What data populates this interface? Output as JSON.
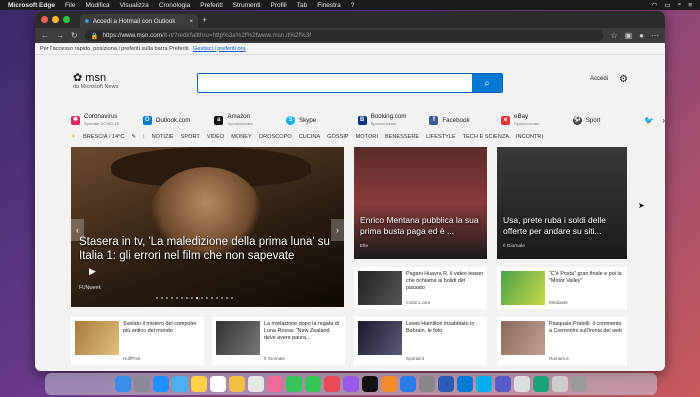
{
  "menubar": {
    "apple": "",
    "app": "Microsoft Edge",
    "items": [
      "File",
      "Modifica",
      "Visualizza",
      "Cronologia",
      "Preferiti",
      "Strumenti",
      "Profili",
      "Tab",
      "Finestra",
      "?"
    ]
  },
  "tab": {
    "title": "Accedi a Hotmail con Outlook"
  },
  "address": {
    "host": "https://www.msn.com",
    "path": "/it-it/?redirfallthru=http%3a%2f%2fwww.msn.it%2f%3f"
  },
  "favbar": {
    "text": "Per l'accesso rapido, posiziona i preferiti sulla barra Preferiti.",
    "link": "Gestisci i preferiti ora"
  },
  "logo": {
    "name": "msn",
    "sub": "da Microsoft News"
  },
  "header": {
    "signin": "Accedi"
  },
  "quick": [
    {
      "label": "Coronavirus",
      "sub": "Speciale COVID-19",
      "color": "#e0245e"
    },
    {
      "label": "Outlook.com",
      "sub": "",
      "color": "#0078d4"
    },
    {
      "label": "Amazon",
      "sub": "Sponsorizzato",
      "color": "#111"
    },
    {
      "label": "Skype",
      "sub": "",
      "color": "#00aff0"
    },
    {
      "label": "Booking.com",
      "sub": "Sponsorizzato",
      "color": "#003580"
    },
    {
      "label": "Facebook",
      "sub": "",
      "color": "#3b5998"
    },
    {
      "label": "eBay",
      "sub": "Sponsorizzato",
      "color": "#e53238"
    },
    {
      "label": "Sport",
      "sub": "",
      "color": "#444"
    }
  ],
  "weather": "BRESCIA / 14°C",
  "nav": [
    "NOTIZIE",
    "SPORT",
    "VIDEO",
    "MONEY",
    "OROSCOPO",
    "CUCINA",
    "GOSSIP",
    "MOTORI",
    "BENESSERE",
    "LIFESTYLE",
    "TECH E SCIENZA",
    "INCONTRI"
  ],
  "hero": {
    "title": "Stasera in tv, 'La maledizione della prima luna' su Italia 1: gli errori nel film che non sapevate",
    "source": "FUNweek"
  },
  "cards": [
    {
      "title": "Enrico Mentana pubblica la sua prima busta paga ed è ...",
      "source": "Elle"
    },
    {
      "title": "Usa, prete ruba i soldi delle offerte per andare su siti...",
      "source": "Il Giornale"
    },
    {
      "title": "Pagani Huayra R, il video teaser che richiama ai bolidi del passato",
      "source": "motor1.com"
    },
    {
      "title": "\"C'è Posta\" gran finale e poi la \"Motor Valley\"",
      "source": "Mediaset"
    },
    {
      "title": "Svelato il mistero del computer più antico del mondo",
      "source": "HuffPost"
    },
    {
      "title": "La rivelazione dopo la regata di Luna Rossa: \"New Zealand deve avere paura...",
      "source": "Il Giornale"
    },
    {
      "title": "Lewis Hamilton insabbiato in Bahrain, le foto",
      "source": "Sportal.it"
    },
    {
      "title": "Pasquale Pratelli: il commento a Cremonini sull'ironia del web",
      "source": "Rumors.it"
    }
  ]
}
